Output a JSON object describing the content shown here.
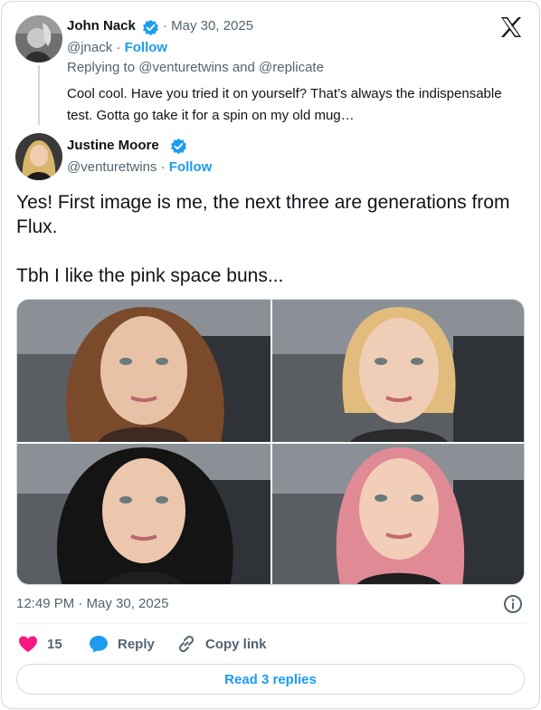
{
  "parent_tweet": {
    "author_name": "John Nack",
    "date": "May 30, 2025",
    "handle": "@jnack",
    "follow_label": "Follow",
    "replying_to": "Replying to @venturetwins and @replicate",
    "text": "Cool cool. Have you tried it on yourself? That’s always the indispensable test. Gotta go take it for a spin on my old mug…"
  },
  "main_tweet": {
    "author_name": "Justine Moore",
    "handle": "@venturetwins",
    "follow_label": "Follow",
    "text_line1": "Yes! First image is me, the next three are generations from Flux.",
    "text_line2": "Tbh I like the pink space buns...",
    "timestamp": "12:49 PM · May 30, 2025"
  },
  "actions": {
    "like_count": "15",
    "reply_label": "Reply",
    "copy_link_label": "Copy link",
    "read_replies_label": "Read 3 replies"
  },
  "colors": {
    "accent": "#1d9bf0",
    "like": "#f91880",
    "muted": "#536471"
  },
  "icons": [
    "x-logo-icon",
    "verified-badge-icon",
    "heart-icon",
    "reply-bubble-icon",
    "link-icon",
    "info-icon"
  ]
}
